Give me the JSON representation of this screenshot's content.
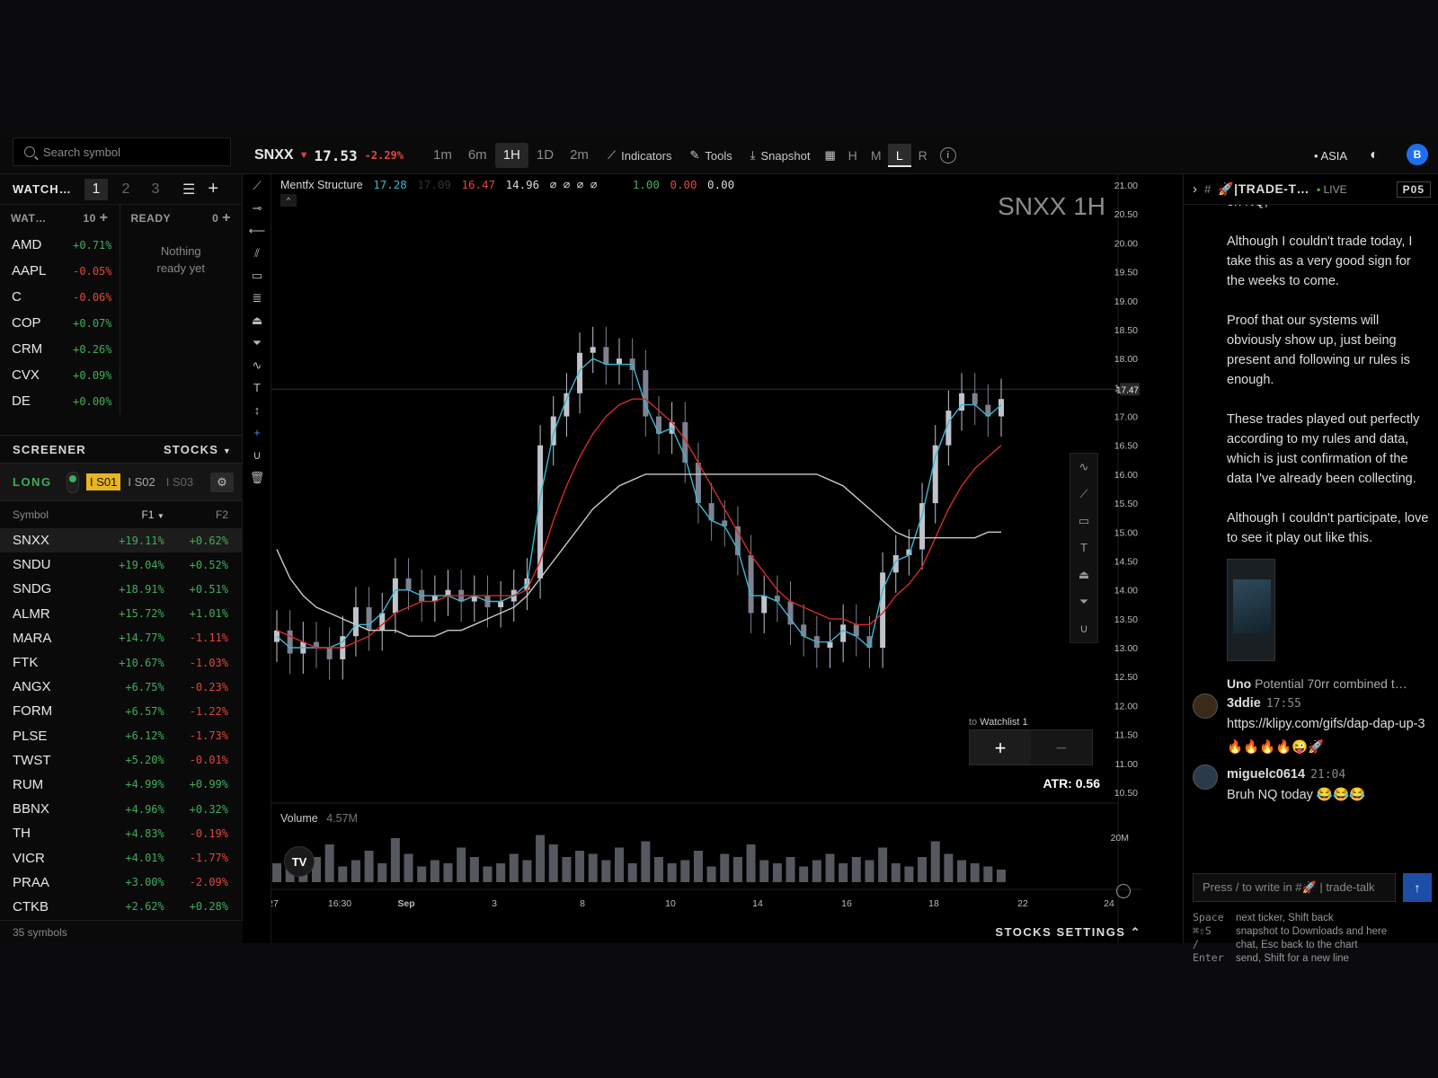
{
  "header": {
    "search_placeholder": "Search symbol",
    "symbol": "SNXX",
    "price": "17.53",
    "change": "-2.29%",
    "timeframes": [
      "1m",
      "6m",
      "1H",
      "1D",
      "2m"
    ],
    "active_timeframe": "1H",
    "indicators_label": "Indicators",
    "tools_label": "Tools",
    "snapshot_label": "Snapshot",
    "view_modes": [
      "H",
      "M",
      "L",
      "R"
    ],
    "active_view_mode": "L",
    "session": "• ASIA",
    "avatar": "B"
  },
  "watchlist": {
    "title": "WATCH…",
    "tabs": [
      "1",
      "2",
      "3"
    ],
    "col_a_title": "WAT…",
    "col_a_count": "10",
    "col_b_title": "READY",
    "col_b_count": "0",
    "empty_text_1": "Nothing",
    "empty_text_2": "ready yet",
    "items": [
      {
        "t": "AMD",
        "p": "+0.71%"
      },
      {
        "t": "AAPL",
        "p": "-0.05%"
      },
      {
        "t": "C",
        "p": "-0.06%"
      },
      {
        "t": "COP",
        "p": "+0.07%"
      },
      {
        "t": "CRM",
        "p": "+0.26%"
      },
      {
        "t": "CVX",
        "p": "+0.09%"
      },
      {
        "t": "DE",
        "p": "+0.00%"
      }
    ]
  },
  "screener": {
    "title": "SCREENER",
    "filter": "STOCKS",
    "mode": "LONG",
    "presets": [
      "S01",
      "S02",
      "S03"
    ],
    "col_symbol": "Symbol",
    "col_f1": "F1",
    "col_f2": "F2",
    "rows": [
      {
        "s": "SNXX",
        "f1": "+19.11%",
        "f2": "+0.62%"
      },
      {
        "s": "SNDU",
        "f1": "+19.04%",
        "f2": "+0.52%"
      },
      {
        "s": "SNDG",
        "f1": "+18.91%",
        "f2": "+0.51%"
      },
      {
        "s": "ALMR",
        "f1": "+15.72%",
        "f2": "+1.01%"
      },
      {
        "s": "MARA",
        "f1": "+14.77%",
        "f2": "-1.11%"
      },
      {
        "s": "FTK",
        "f1": "+10.67%",
        "f2": "-1.03%"
      },
      {
        "s": "ANGX",
        "f1": "+6.75%",
        "f2": "-0.23%"
      },
      {
        "s": "FORM",
        "f1": "+6.57%",
        "f2": "-1.22%"
      },
      {
        "s": "PLSE",
        "f1": "+6.12%",
        "f2": "-1.73%"
      },
      {
        "s": "TWST",
        "f1": "+5.20%",
        "f2": "-0.01%"
      },
      {
        "s": "RUM",
        "f1": "+4.99%",
        "f2": "+0.99%"
      },
      {
        "s": "BBNX",
        "f1": "+4.96%",
        "f2": "+0.32%"
      },
      {
        "s": "TH",
        "f1": "+4.83%",
        "f2": "-0.19%"
      },
      {
        "s": "VICR",
        "f1": "+4.01%",
        "f2": "-1.77%"
      },
      {
        "s": "PRAA",
        "f1": "+3.00%",
        "f2": "-2.09%"
      },
      {
        "s": "CTKB",
        "f1": "+2.62%",
        "f2": "+0.28%"
      }
    ],
    "footer": "35 symbols"
  },
  "chart": {
    "indicator_name": "Mentfx Structure",
    "legend_values": [
      "17.28",
      "17.09",
      "16.47",
      "14.96",
      "∅ ∅ ∅ ∅",
      "1.00",
      "0.00",
      "0.00"
    ],
    "title": "SNXX 1H",
    "atr": "ATR: 0.56",
    "last_price_tag": "17.47",
    "volume_label": "Volume",
    "volume_value": "4.57M",
    "volume_axis": "20M",
    "watchlist_popup": "Watchlist 1",
    "watchlist_popup_prefix": "to",
    "settings_label": "STOCKS SETTINGS",
    "tv_logo": "TV",
    "colors": {
      "up": "#3fae5a",
      "down": "#e0463b",
      "cyan": "#3ab9d0",
      "ma_red": "#d42a2a",
      "ma_white": "#c8c8c8"
    }
  },
  "chart_data": {
    "type": "line",
    "title": "SNXX 1H",
    "y_ticks": [
      "21.00",
      "20.50",
      "20.00",
      "19.50",
      "19.00",
      "18.50",
      "18.00",
      "17.50",
      "17.00",
      "16.50",
      "16.00",
      "15.50",
      "15.00",
      "14.50",
      "14.00",
      "13.50",
      "13.00",
      "12.50",
      "12.00",
      "11.50",
      "11.00",
      "10.50"
    ],
    "x_ticks": [
      "27",
      "16:30",
      "Sep",
      "3",
      "8",
      "10",
      "14",
      "16",
      "18",
      "22",
      "24"
    ],
    "ylim": [
      10.5,
      21.0
    ],
    "series": [
      {
        "name": "close",
        "values": [
          13.3,
          12.9,
          13.1,
          13.0,
          12.8,
          13.2,
          13.7,
          13.3,
          13.6,
          14.2,
          14.0,
          13.8,
          13.9,
          14.0,
          13.8,
          13.9,
          13.7,
          13.8,
          14.0,
          14.2,
          16.5,
          17.0,
          17.4,
          18.1,
          18.2,
          17.9,
          18.0,
          17.8,
          17.0,
          16.7,
          16.9,
          16.2,
          15.5,
          15.2,
          15.1,
          14.6,
          13.6,
          13.9,
          13.8,
          13.4,
          13.2,
          13.0,
          13.1,
          13.4,
          13.2,
          13.0,
          14.3,
          14.6,
          14.7,
          15.5,
          16.5,
          17.1,
          17.4,
          17.2,
          17.0,
          17.3
        ]
      },
      {
        "name": "cyan_ma",
        "values": [
          13.2,
          13.0,
          13.0,
          13.0,
          13.0,
          13.1,
          13.4,
          13.4,
          13.6,
          14.0,
          14.0,
          13.9,
          13.9,
          13.9,
          13.8,
          13.9,
          13.8,
          13.8,
          13.9,
          14.1,
          15.6,
          16.7,
          17.3,
          17.8,
          18.0,
          17.9,
          17.9,
          17.9,
          17.2,
          16.7,
          16.8,
          16.3,
          15.5,
          15.2,
          15.1,
          14.7,
          13.9,
          13.9,
          13.8,
          13.5,
          13.2,
          13.1,
          13.1,
          13.3,
          13.2,
          13.0,
          14.0,
          14.5,
          14.6,
          15.3,
          16.3,
          16.9,
          17.2,
          17.2,
          17.0,
          17.2
        ]
      },
      {
        "name": "red_ma",
        "values": [
          13.3,
          13.2,
          13.1,
          13.0,
          13.0,
          13.0,
          13.1,
          13.2,
          13.4,
          13.6,
          13.7,
          13.8,
          13.8,
          13.9,
          13.9,
          13.9,
          13.9,
          13.9,
          13.9,
          14.0,
          14.5,
          15.2,
          15.8,
          16.3,
          16.7,
          17.0,
          17.2,
          17.3,
          17.3,
          17.1,
          16.9,
          16.6,
          16.2,
          15.8,
          15.4,
          15.0,
          14.6,
          14.3,
          14.0,
          13.8,
          13.7,
          13.6,
          13.5,
          13.5,
          13.4,
          13.4,
          13.6,
          13.9,
          14.1,
          14.4,
          14.9,
          15.4,
          15.8,
          16.1,
          16.3,
          16.5
        ]
      },
      {
        "name": "white_ma",
        "values": [
          14.7,
          14.2,
          13.9,
          13.7,
          13.6,
          13.5,
          13.4,
          13.3,
          13.3,
          13.3,
          13.2,
          13.2,
          13.2,
          13.3,
          13.3,
          13.4,
          13.5,
          13.6,
          13.7,
          13.9,
          14.2,
          14.5,
          14.8,
          15.1,
          15.4,
          15.6,
          15.8,
          15.9,
          16.0,
          16.0,
          16.0,
          16.0,
          16.0,
          16.0,
          16.0,
          16.0,
          16.0,
          16.0,
          16.0,
          16.0,
          16.0,
          16.0,
          15.9,
          15.8,
          15.6,
          15.4,
          15.2,
          15.0,
          14.9,
          14.9,
          14.9,
          14.9,
          14.9,
          14.9,
          15.0,
          15.0
        ]
      }
    ],
    "volume": [
      6,
      9,
      4,
      8,
      12,
      5,
      7,
      10,
      6,
      14,
      9,
      5,
      7,
      6,
      11,
      8,
      5,
      6,
      9,
      7,
      15,
      12,
      8,
      10,
      9,
      7,
      11,
      6,
      13,
      8,
      6,
      7,
      10,
      5,
      9,
      8,
      12,
      7,
      6,
      8,
      5,
      7,
      9,
      6,
      8,
      7,
      11,
      6,
      5,
      8,
      13,
      9,
      7,
      6,
      5,
      4
    ]
  },
  "chat": {
    "channel": "🚀|TRADE-T…",
    "live": "LIVE",
    "code": "P05",
    "messages": [
      "on NQ,",
      "Although I couldn't trade today, I take this as a very good sign for the weeks to come.",
      "Proof that our systems will obviously show up, just being present and following ur rules is enough.",
      "These trades played out perfectly according to my rules and data, which is just confirmation of the data I've already been collecting.",
      "Although I couldn't participate, love to see it play out like this."
    ],
    "reply_user": "Uno",
    "reply_text": "Potential 70rr combined t…",
    "user1": "3ddie",
    "time1": "17:55",
    "msg1": "https://klipy.com/gifs/dap-dap-up-3",
    "msg1b": "🔥🔥🔥🔥😜🚀",
    "user2": "miguelc0614",
    "time2": "21:04",
    "msg2": "Bruh NQ today 😂😂😂",
    "composer_placeholder": "Press / to write in #🚀 | trade-talk",
    "hints": [
      {
        "k": "Space",
        "v": "next ticker, Shift back"
      },
      {
        "k": "⌘⇧S",
        "v": "snapshot to Downloads and here"
      },
      {
        "k": "/",
        "v": "chat, Esc back to the chart"
      },
      {
        "k": "Enter",
        "v": "send, Shift for a new line"
      }
    ]
  }
}
